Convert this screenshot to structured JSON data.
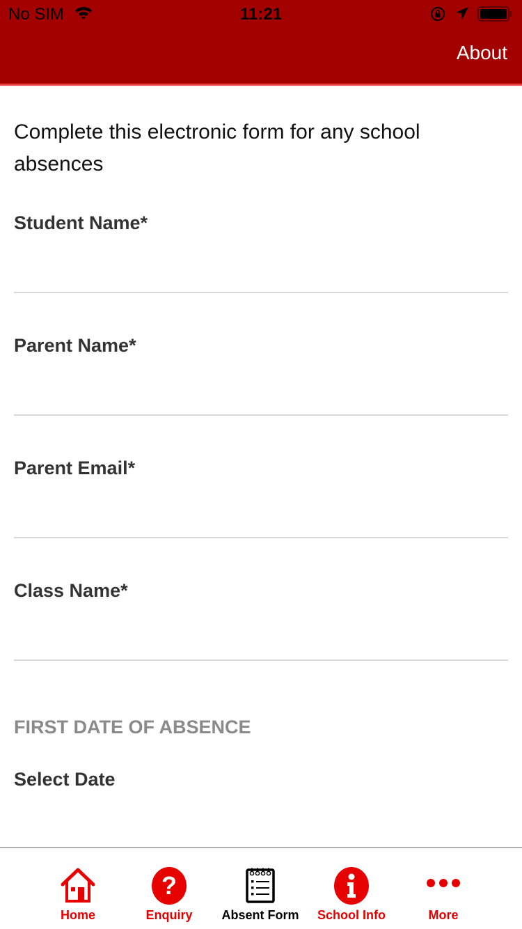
{
  "status_bar": {
    "carrier": "No SIM",
    "time": "11:21"
  },
  "nav": {
    "right_button": "About"
  },
  "form": {
    "intro": "Complete this electronic form for any school absences",
    "fields": [
      {
        "label": "Student Name*",
        "value": "",
        "placeholder": ""
      },
      {
        "label": "Parent Name*",
        "value": "",
        "placeholder": ""
      },
      {
        "label": "Parent Email*",
        "value": "",
        "placeholder": ""
      },
      {
        "label": "Class Name*",
        "value": "",
        "placeholder": ""
      }
    ],
    "section_first_date": "FIRST DATE OF ABSENCE",
    "select_date": "Select Date"
  },
  "tabs": [
    {
      "label": "Home",
      "icon": "home-icon",
      "active": false
    },
    {
      "label": "Enquiry",
      "icon": "question-icon",
      "active": false
    },
    {
      "label": "Absent Form",
      "icon": "notepad-icon",
      "active": true
    },
    {
      "label": "School Info",
      "icon": "info-icon",
      "active": false
    },
    {
      "label": "More",
      "icon": "more-dots-icon",
      "active": false
    }
  ],
  "colors": {
    "header": "#a30000",
    "accent": "#e60000",
    "header_line": "#ee3b3b"
  }
}
